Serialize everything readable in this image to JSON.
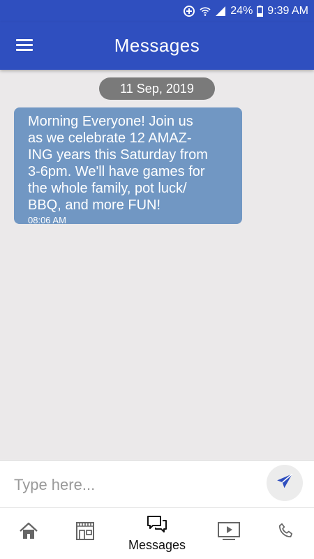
{
  "status_bar": {
    "battery": "24%",
    "time": "9:39 AM"
  },
  "app_bar": {
    "title": "Messages"
  },
  "conversation": {
    "date": "11 Sep, 2019",
    "messages": [
      {
        "text": "Morning Everyone!  Join us\nas we celebrate 12 AMAZ-\nING years this Saturday from\n3-6pm. We'll have games for\nthe whole family, pot luck/\nBBQ, and more FUN!",
        "time": "08:06 AM"
      }
    ]
  },
  "composer": {
    "placeholder": "Type here...",
    "value": ""
  },
  "bottom_nav": {
    "items": [
      {
        "icon": "home-icon",
        "label": ""
      },
      {
        "icon": "store-icon",
        "label": ""
      },
      {
        "icon": "chat-icon",
        "label": "Messages",
        "active": true
      },
      {
        "icon": "video-icon",
        "label": ""
      },
      {
        "icon": "phone-icon",
        "label": ""
      }
    ]
  },
  "colors": {
    "primary": "#2f4fbf",
    "bubble": "#7197c3",
    "date_pill": "#7a7a7a",
    "background": "#ebe9ea",
    "send_icon": "#2f4fbf"
  }
}
